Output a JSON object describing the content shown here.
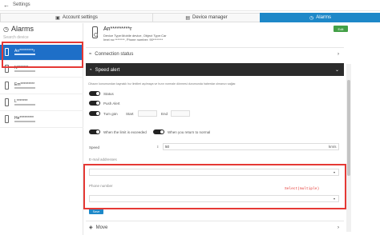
{
  "topbar": {
    "back_icon": "back-arrow-icon",
    "title": "Settings"
  },
  "tabs": [
    {
      "label": "Account settings",
      "icon": "person-icon",
      "active": false
    },
    {
      "label": "Device manager",
      "icon": "computer-icon",
      "active": false
    },
    {
      "label": "Alarms",
      "icon": "clock-icon",
      "active": true
    }
  ],
  "sidebar": {
    "title": "Alarms",
    "search_placeholder": "Search device",
    "devices": [
      {
        "name": "An*********r",
        "selected": true
      },
      {
        "name": "N*******",
        "selected": false
      },
      {
        "name": "Em*********",
        "selected": false
      },
      {
        "name": "L*******",
        "selected": false
      },
      {
        "name": "He*********",
        "selected": false
      }
    ]
  },
  "device": {
    "name": "An*********r",
    "type_line": "Device Type:Mobile device, Object Type:Car",
    "id_line": "Imei no:********, Phone number: 90********",
    "edit_label": "Edit"
  },
  "sections": {
    "connection_status": "Connection status",
    "speed_alert": "Speed alert",
    "move": "Move"
  },
  "speed_alert": {
    "info_text": "Cihazın konumundan kaynaklı hız limitleri aşılmaya ve hızın normale dönmesi durumunda haberdar olmanızı sağlar.",
    "status_label": "Status",
    "push_alert_label": "Push Alert",
    "turn_goin_label": "Tum gün",
    "start_label": "Start",
    "end_label": "End",
    "exceeded_label": "When the limit is exceeded",
    "return_label": "When you return to normal",
    "speed_label": "Speed",
    "speed_value": "50",
    "speed_unit": "km/s",
    "email_label": "E-mail addresses",
    "phone_label": "Phone number",
    "select_hint": "Select(multiple)",
    "save_label": "Save"
  },
  "colors": {
    "accent": "#1e88c8",
    "highlight": "#e53935",
    "selected_row": "#1e6fc8",
    "dark_header": "#2b2b2b",
    "edit_green": "#43a047"
  }
}
